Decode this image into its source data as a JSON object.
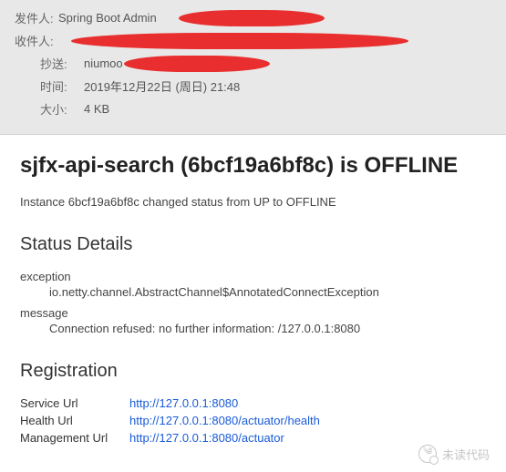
{
  "header": {
    "from_label": "发件人:",
    "from_value": "Spring Boot Admin",
    "to_label": "收件人:",
    "cc_label": "抄送:",
    "cc_value": "niumoo",
    "time_label": "时间:",
    "time_value": "2019年12月22日 (周日) 21:48",
    "size_label": "大小:",
    "size_value": "4 KB"
  },
  "body": {
    "title": "sjfx-api-search (6bcf19a6bf8c) is OFFLINE",
    "status_line": "Instance 6bcf19a6bf8c changed status from UP to OFFLINE",
    "status_details_heading": "Status Details",
    "details": {
      "exception_label": "exception",
      "exception_value": "io.netty.channel.AbstractChannel$AnnotatedConnectException",
      "message_label": "message",
      "message_value": "Connection refused: no further information: /127.0.0.1:8080"
    },
    "registration_heading": "Registration",
    "registration": {
      "service_label": "Service Url",
      "service_url": "http://127.0.0.1:8080",
      "health_label": "Health Url",
      "health_url": "http://127.0.0.1:8080/actuator/health",
      "management_label": "Management Url",
      "management_url": "http://127.0.0.1:8080/actuator"
    }
  },
  "watermark": "未读代码"
}
